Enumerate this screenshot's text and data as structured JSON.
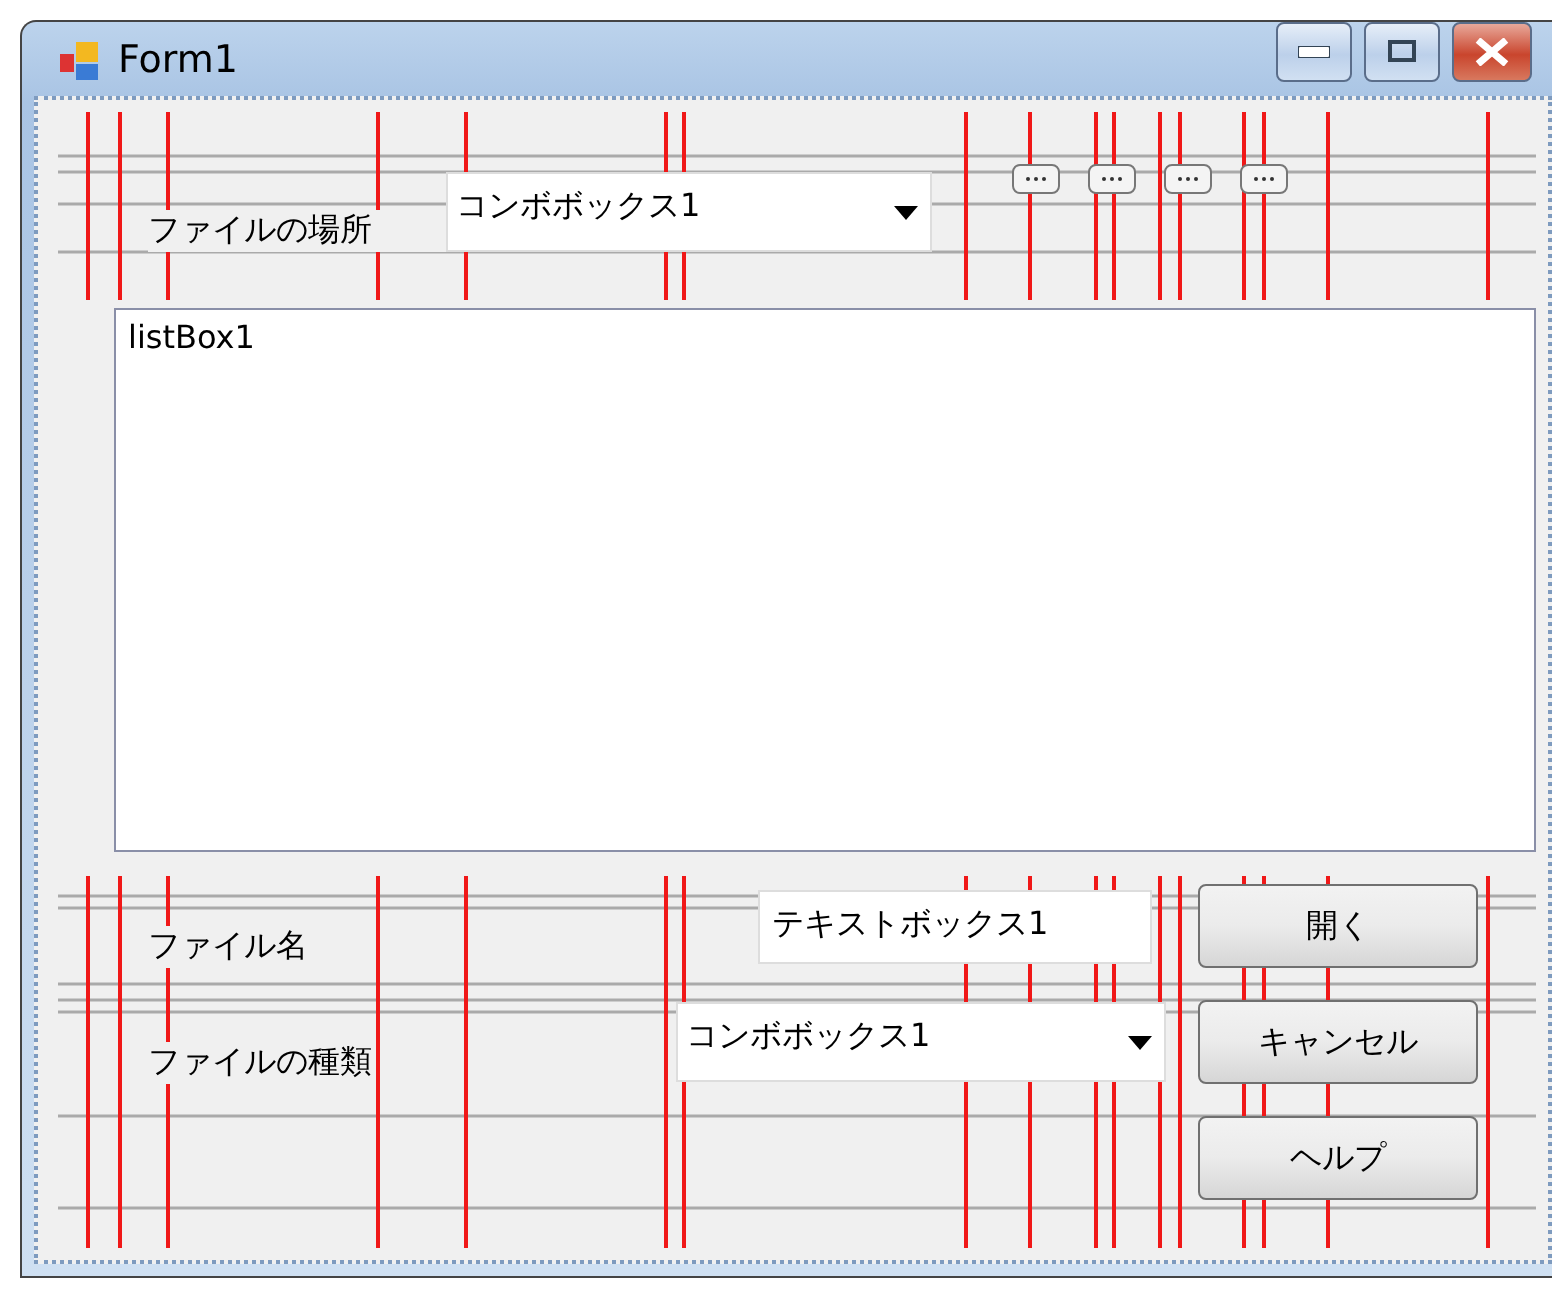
{
  "window": {
    "title": "Form1"
  },
  "top_panel": {
    "label": "ファイルの場所",
    "combo": {
      "value": "コンボボックス1"
    },
    "toolbar_buttons": [
      {
        "kind": "ellipsis"
      },
      {
        "kind": "ellipsis"
      },
      {
        "kind": "ellipsis"
      },
      {
        "kind": "ellipsis"
      }
    ]
  },
  "list_box": {
    "items": [
      "listBox1"
    ]
  },
  "bottom_panel": {
    "file_name_label": "ファイル名",
    "file_name_field": {
      "value": "テキストボックス1"
    },
    "file_type_label": "ファイルの種類",
    "file_type_combo": {
      "value": "コンボボックス1"
    },
    "buttons": [
      "開く",
      "キャンセル",
      "ヘルプ"
    ]
  }
}
